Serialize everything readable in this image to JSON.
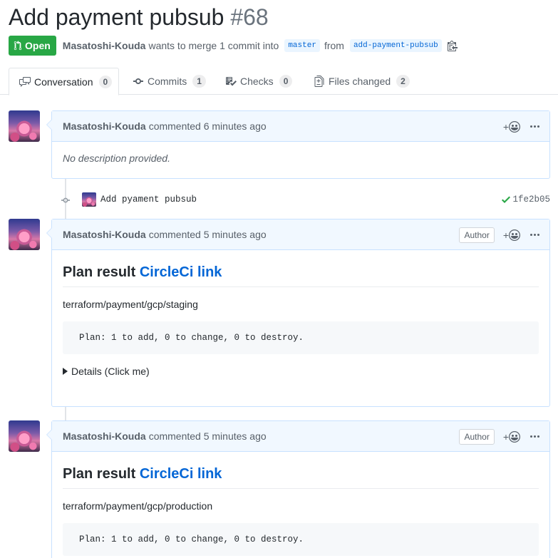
{
  "pr": {
    "title": "Add payment pubsub",
    "number": "#68",
    "state": "Open",
    "author": "Masatoshi-Kouda",
    "merge_text": "wants to merge 1 commit into",
    "base_branch": "master",
    "from_text": "from",
    "head_branch": "add-payment-pubsub"
  },
  "tabs": [
    {
      "label": "Conversation",
      "count": "0",
      "icon": "comment-discussion-icon"
    },
    {
      "label": "Commits",
      "count": "1",
      "icon": "git-commit-icon"
    },
    {
      "label": "Checks",
      "count": "0",
      "icon": "checklist-icon"
    },
    {
      "label": "Files changed",
      "count": "2",
      "icon": "file-diff-icon"
    }
  ],
  "comments": [
    {
      "author": "Masatoshi-Kouda",
      "meta": "commented 6 minutes ago",
      "body": "No description provided."
    },
    {
      "author": "Masatoshi-Kouda",
      "meta": "commented 5 minutes ago",
      "badge": "Author",
      "heading": "Plan result",
      "link": "CircleCi link",
      "path": "terraform/payment/gcp/staging",
      "code": "Plan: 1 to add, 0 to change, 0 to destroy.",
      "details": "Details (Click me)"
    },
    {
      "author": "Masatoshi-Kouda",
      "meta": "commented 5 minutes ago",
      "badge": "Author",
      "heading": "Plan result",
      "link": "CircleCi link",
      "path": "terraform/payment/gcp/production",
      "code": "Plan: 1 to add, 0 to change, 0 to destroy."
    }
  ],
  "commit": {
    "message": "Add pyament pubsub",
    "sha": "1fe2b05",
    "status": "success"
  },
  "reaction_label": "+",
  "colors": {
    "open_green": "#28a745",
    "link_blue": "#0366d6",
    "comment_header_bg": "#f1f8ff",
    "comment_border": "#c8e1ff"
  }
}
